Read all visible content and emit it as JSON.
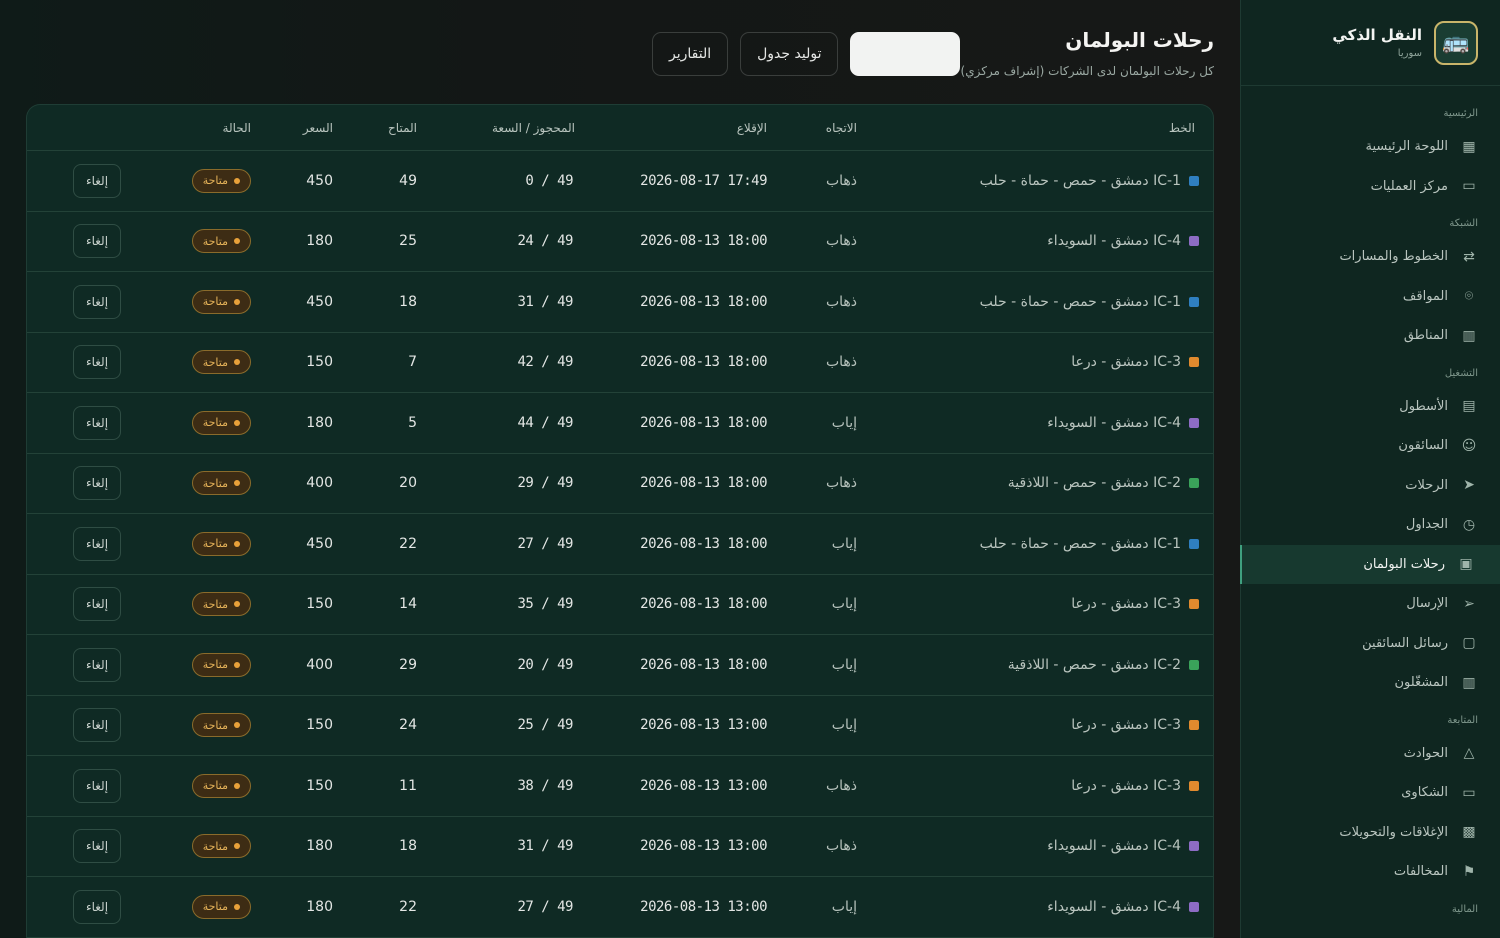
{
  "brand": {
    "title": "النقل الذكي",
    "subtitle": "سوريا",
    "logo_icon": "bus-logo-icon"
  },
  "nav": {
    "groups": [
      {
        "label": "الرئيسية",
        "items": [
          {
            "label": "اللوحة الرئيسية",
            "icon": "dashboard-icon"
          },
          {
            "label": "مركز العمليات",
            "icon": "monitor-icon"
          }
        ]
      },
      {
        "label": "الشبكة",
        "items": [
          {
            "label": "الخطوط والمسارات",
            "icon": "route-icon"
          },
          {
            "label": "المواقف",
            "icon": "map-pin-icon"
          },
          {
            "label": "المناطق",
            "icon": "map-icon"
          }
        ]
      },
      {
        "label": "التشغيل",
        "items": [
          {
            "label": "الأسطول",
            "icon": "bus-icon"
          },
          {
            "label": "السائقون",
            "icon": "users-icon"
          },
          {
            "label": "الرحلات",
            "icon": "navigation-icon"
          },
          {
            "label": "الجداول",
            "icon": "clock-icon"
          },
          {
            "label": "رحلات البولمان",
            "icon": "coach-icon",
            "active": true
          },
          {
            "label": "الإرسال",
            "icon": "send-icon"
          },
          {
            "label": "رسائل السائقين",
            "icon": "messages-icon"
          },
          {
            "label": "المشغّلون",
            "icon": "building-icon"
          }
        ]
      },
      {
        "label": "المتابعة",
        "items": [
          {
            "label": "الحوادث",
            "icon": "alert-triangle-icon"
          },
          {
            "label": "الشكاوى",
            "icon": "complaint-icon"
          },
          {
            "label": "الإغلاقات والتحويلات",
            "icon": "barrier-icon"
          },
          {
            "label": "المخالفات",
            "icon": "flag-icon"
          }
        ]
      },
      {
        "label": "المالية",
        "items": []
      }
    ]
  },
  "header": {
    "title": "رحلات البولمان",
    "subtitle": "كل رحلات البولمان لدى الشركات (إشراف مركزي)",
    "reports_label": "التقارير",
    "generate_label": "توليد جدول",
    "primary_label": ""
  },
  "table": {
    "columns": {
      "line": "الخط",
      "direction": "الاتجاه",
      "departure": "الإقلاع",
      "booked": "المحجوز / السعة",
      "available": "المتاح",
      "price": "السعر",
      "status": "الحالة"
    },
    "cancel_label": "إلغاء",
    "line_colors": {
      "IC-1": "#2f7fc0",
      "IC-2": "#3aa35a",
      "IC-3": "#e08a2e",
      "IC-4": "#8d6cc4"
    },
    "rows": [
      {
        "line": "IC-1 دمشق - حمص - حماة - حلب",
        "code": "IC-1",
        "direction": "ذهاب",
        "departure": "2026-08-17 17:49",
        "booked": "0 / 49",
        "available": "49",
        "price": "450",
        "status": "متاحة"
      },
      {
        "line": "IC-4 دمشق - السويداء",
        "code": "IC-4",
        "direction": "ذهاب",
        "departure": "2026-08-13 18:00",
        "booked": "24 / 49",
        "available": "25",
        "price": "180",
        "status": "متاحة"
      },
      {
        "line": "IC-1 دمشق - حمص - حماة - حلب",
        "code": "IC-1",
        "direction": "ذهاب",
        "departure": "2026-08-13 18:00",
        "booked": "31 / 49",
        "available": "18",
        "price": "450",
        "status": "متاحة"
      },
      {
        "line": "IC-3 دمشق - درعا",
        "code": "IC-3",
        "direction": "ذهاب",
        "departure": "2026-08-13 18:00",
        "booked": "42 / 49",
        "available": "7",
        "price": "150",
        "status": "متاحة"
      },
      {
        "line": "IC-4 دمشق - السويداء",
        "code": "IC-4",
        "direction": "إياب",
        "departure": "2026-08-13 18:00",
        "booked": "44 / 49",
        "available": "5",
        "price": "180",
        "status": "متاحة"
      },
      {
        "line": "IC-2 دمشق - حمص - اللاذقية",
        "code": "IC-2",
        "direction": "ذهاب",
        "departure": "2026-08-13 18:00",
        "booked": "29 / 49",
        "available": "20",
        "price": "400",
        "status": "متاحة"
      },
      {
        "line": "IC-1 دمشق - حمص - حماة - حلب",
        "code": "IC-1",
        "direction": "إياب",
        "departure": "2026-08-13 18:00",
        "booked": "27 / 49",
        "available": "22",
        "price": "450",
        "status": "متاحة"
      },
      {
        "line": "IC-3 دمشق - درعا",
        "code": "IC-3",
        "direction": "إياب",
        "departure": "2026-08-13 18:00",
        "booked": "35 / 49",
        "available": "14",
        "price": "150",
        "status": "متاحة"
      },
      {
        "line": "IC-2 دمشق - حمص - اللاذقية",
        "code": "IC-2",
        "direction": "إياب",
        "departure": "2026-08-13 18:00",
        "booked": "20 / 49",
        "available": "29",
        "price": "400",
        "status": "متاحة"
      },
      {
        "line": "IC-3 دمشق - درعا",
        "code": "IC-3",
        "direction": "إياب",
        "departure": "2026-08-13 13:00",
        "booked": "25 / 49",
        "available": "24",
        "price": "150",
        "status": "متاحة"
      },
      {
        "line": "IC-3 دمشق - درعا",
        "code": "IC-3",
        "direction": "ذهاب",
        "departure": "2026-08-13 13:00",
        "booked": "38 / 49",
        "available": "11",
        "price": "150",
        "status": "متاحة"
      },
      {
        "line": "IC-4 دمشق - السويداء",
        "code": "IC-4",
        "direction": "ذهاب",
        "departure": "2026-08-13 13:00",
        "booked": "31 / 49",
        "available": "18",
        "price": "180",
        "status": "متاحة"
      },
      {
        "line": "IC-4 دمشق - السويداء",
        "code": "IC-4",
        "direction": "إياب",
        "departure": "2026-08-13 13:00",
        "booked": "27 / 49",
        "available": "22",
        "price": "180",
        "status": "متاحة"
      }
    ]
  }
}
